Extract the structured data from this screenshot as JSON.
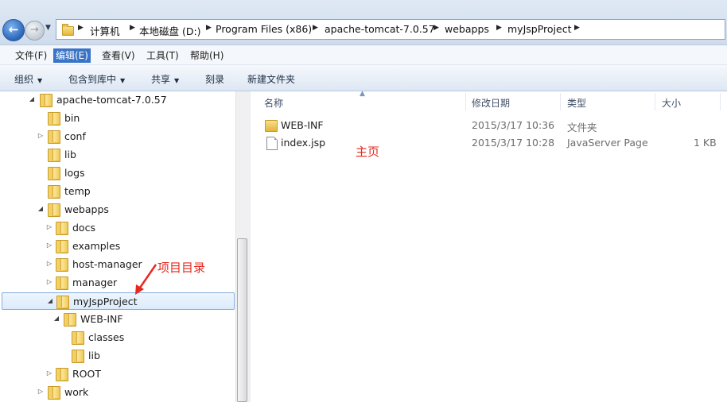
{
  "address_bar": {
    "breadcrumbs": [
      "计算机",
      "本地磁盘 (D:)",
      "Program Files (x86)",
      "apache-tomcat-7.0.57",
      "webapps",
      "myJspProject"
    ]
  },
  "menu": {
    "items": [
      "文件(F)",
      "编辑(E)",
      "查看(V)",
      "工具(T)",
      "帮助(H)"
    ]
  },
  "toolbar": {
    "organize": "组织",
    "include_library": "包含到库中",
    "share": "共享",
    "burn": "刻录",
    "new_folder": "新建文件夹"
  },
  "tree": {
    "items": [
      {
        "label": "apache-tomcat-7.0.57",
        "expander": "◢"
      },
      {
        "label": "bin",
        "expander": ""
      },
      {
        "label": "conf",
        "expander": "▷"
      },
      {
        "label": "lib",
        "expander": ""
      },
      {
        "label": "logs",
        "expander": ""
      },
      {
        "label": "temp",
        "expander": ""
      },
      {
        "label": "webapps",
        "expander": "◢"
      },
      {
        "label": "docs",
        "expander": "▷"
      },
      {
        "label": "examples",
        "expander": "▷"
      },
      {
        "label": "host-manager",
        "expander": "▷"
      },
      {
        "label": "manager",
        "expander": "▷"
      },
      {
        "label": "myJspProject",
        "expander": "◢"
      },
      {
        "label": "WEB-INF",
        "expander": "◢"
      },
      {
        "label": "classes",
        "expander": ""
      },
      {
        "label": "lib",
        "expander": ""
      },
      {
        "label": "ROOT",
        "expander": "▷"
      },
      {
        "label": "work",
        "expander": "▷"
      }
    ]
  },
  "list": {
    "columns": [
      "名称",
      "修改日期",
      "类型",
      "大小"
    ],
    "rows": [
      {
        "name": "WEB-INF",
        "modified": "2015/3/17 10:36",
        "type": "文件夹",
        "size": "",
        "icon": "folder-icon"
      },
      {
        "name": "index.jsp",
        "modified": "2015/3/17 10:28",
        "type": "JavaServer Page",
        "size": "1 KB",
        "icon": "file-icon"
      }
    ]
  },
  "annotations": {
    "home_page": "主页",
    "project_dir": "项目目录"
  },
  "colors": {
    "accent": "#3a74c6",
    "annotation": "#e8281e",
    "selection_border": "#84acdd"
  }
}
